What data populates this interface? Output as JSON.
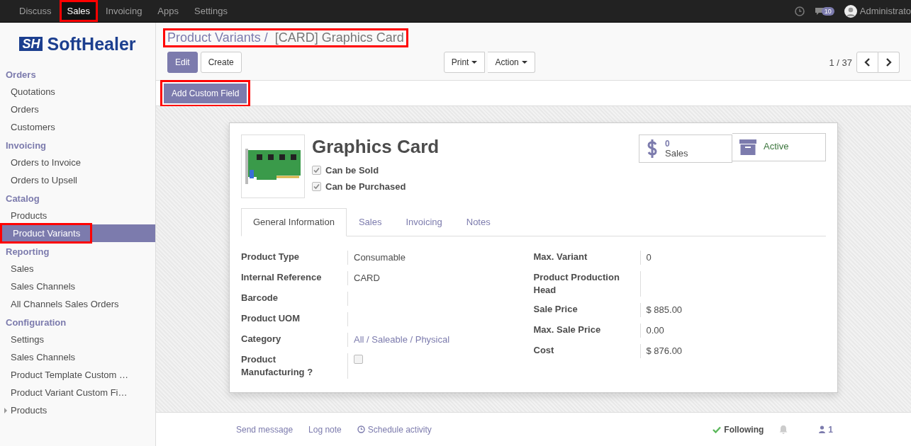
{
  "top_menu": [
    {
      "label": "Discuss",
      "selected": false,
      "highlighted": false
    },
    {
      "label": "Sales",
      "selected": true,
      "highlighted": true
    },
    {
      "label": "Invoicing",
      "selected": false,
      "highlighted": false
    },
    {
      "label": "Apps",
      "selected": false,
      "highlighted": false
    },
    {
      "label": "Settings",
      "selected": false,
      "highlighted": false
    }
  ],
  "systray": {
    "message_count": "10",
    "user": "Administrato"
  },
  "logo": {
    "mark": "SH",
    "text": "SoftHealer"
  },
  "sidebar": [
    {
      "title": "Orders",
      "items": [
        {
          "label": "Quotations",
          "selected": false,
          "highlighted": false
        },
        {
          "label": "Orders",
          "selected": false,
          "highlighted": false
        },
        {
          "label": "Customers",
          "selected": false,
          "highlighted": false
        }
      ]
    },
    {
      "title": "Invoicing",
      "items": [
        {
          "label": "Orders to Invoice",
          "selected": false,
          "highlighted": false
        },
        {
          "label": "Orders to Upsell",
          "selected": false,
          "highlighted": false
        }
      ]
    },
    {
      "title": "Catalog",
      "items": [
        {
          "label": "Products",
          "selected": false,
          "highlighted": false
        },
        {
          "label": "Product Variants",
          "selected": true,
          "highlighted": true
        }
      ]
    },
    {
      "title": "Reporting",
      "items": [
        {
          "label": "Sales",
          "selected": false,
          "highlighted": false
        },
        {
          "label": "Sales Channels",
          "selected": false,
          "highlighted": false
        },
        {
          "label": "All Channels Sales Orders",
          "selected": false,
          "highlighted": false
        }
      ]
    },
    {
      "title": "Configuration",
      "items": [
        {
          "label": "Settings",
          "selected": false,
          "highlighted": false
        },
        {
          "label": "Sales Channels",
          "selected": false,
          "highlighted": false
        },
        {
          "label": "Product Template Custom …",
          "selected": false,
          "highlighted": false
        },
        {
          "label": "Product Variant Custom Fi…",
          "selected": false,
          "highlighted": false
        },
        {
          "label": "Products",
          "selected": false,
          "highlighted": false,
          "expanded": false
        }
      ]
    }
  ],
  "breadcrumb": {
    "parent": "Product Variants /",
    "current": "[CARD] Graphics Card",
    "highlighted": true
  },
  "buttons": {
    "edit": "Edit",
    "create": "Create",
    "print": "Print",
    "action": "Action",
    "custom_field": "Add Custom Field",
    "custom_field_highlighted": true
  },
  "pager": "1 / 37",
  "product": {
    "name": "Graphics Card",
    "flags": [
      {
        "label": "Can be Sold",
        "checked": true
      },
      {
        "label": "Can be Purchased",
        "checked": true
      }
    ]
  },
  "smart_buttons": [
    {
      "kind": "stat",
      "value": "0",
      "label": "Sales"
    },
    {
      "kind": "toggle",
      "label": "Active"
    }
  ],
  "tabs": [
    {
      "label": "General Information",
      "selected": true
    },
    {
      "label": "Sales",
      "selected": false
    },
    {
      "label": "Invoicing",
      "selected": false
    },
    {
      "label": "Notes",
      "selected": false
    }
  ],
  "left_fields": [
    {
      "label": "Product Type",
      "kind": "text",
      "value": "Consumable"
    },
    {
      "label": "Internal Reference",
      "kind": "text",
      "value": "CARD"
    },
    {
      "label": "Barcode",
      "kind": "empty"
    },
    {
      "label": "Product UOM",
      "kind": "empty"
    },
    {
      "label": "Category",
      "kind": "link",
      "value": "All / Saleable / Physical"
    },
    {
      "label": "Product Manufacturing ?",
      "kind": "checkbox",
      "checked": false
    }
  ],
  "right_fields": [
    {
      "label": "Max. Variant",
      "kind": "text",
      "value": "0"
    },
    {
      "label": "Product Production Head",
      "kind": "empty"
    },
    {
      "label": "Sale Price",
      "kind": "text",
      "value": "$ 885.00"
    },
    {
      "label": "Max. Sale Price",
      "kind": "text",
      "value": "0.00"
    },
    {
      "label": "Cost",
      "kind": "text",
      "value": "$ 876.00"
    }
  ],
  "chatter": {
    "send": "Send message",
    "log": "Log note",
    "schedule": "Schedule activity",
    "following": "Following",
    "followers": "1"
  }
}
